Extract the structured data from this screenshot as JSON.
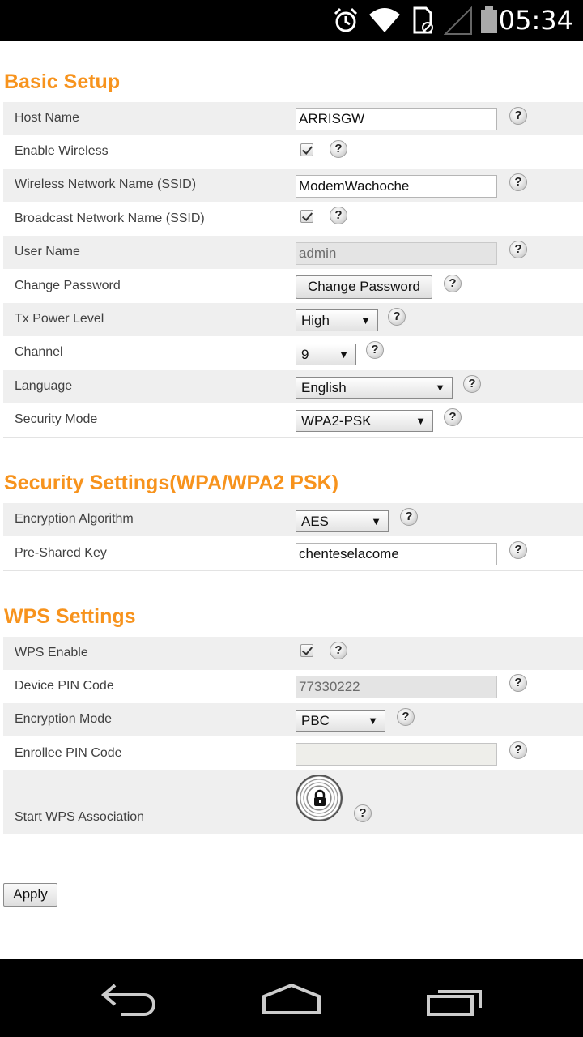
{
  "status_bar": {
    "time": "05:34",
    "icons": [
      "alarm-icon",
      "wifi-icon",
      "sim-icon",
      "signal-icon",
      "battery-icon"
    ]
  },
  "basic_setup": {
    "title": "Basic Setup",
    "host_name": {
      "label": "Host Name",
      "value": "ARRISGW"
    },
    "enable_wireless": {
      "label": "Enable Wireless",
      "checked": true
    },
    "ssid": {
      "label": "Wireless Network Name (SSID)",
      "value": "ModemWachoche"
    },
    "broadcast_ssid": {
      "label": "Broadcast Network Name (SSID)",
      "checked": true
    },
    "user_name": {
      "label": "User Name",
      "value": "admin"
    },
    "change_password": {
      "label": "Change Password",
      "button": "Change Password"
    },
    "tx_power": {
      "label": "Tx Power Level",
      "value": "High"
    },
    "channel": {
      "label": "Channel",
      "value": "9"
    },
    "language": {
      "label": "Language",
      "value": "English"
    },
    "security_mode": {
      "label": "Security Mode",
      "value": "WPA2-PSK"
    }
  },
  "security_settings": {
    "title": "Security Settings(WPA/WPA2 PSK)",
    "encryption_algorithm": {
      "label": "Encryption Algorithm",
      "value": "AES"
    },
    "pre_shared_key": {
      "label": "Pre-Shared Key",
      "value": "chenteselacome"
    }
  },
  "wps_settings": {
    "title": "WPS Settings",
    "wps_enable": {
      "label": "WPS Enable",
      "checked": true
    },
    "device_pin": {
      "label": "Device PIN Code",
      "value": "77330222"
    },
    "encryption_mode": {
      "label": "Encryption Mode",
      "value": "PBC"
    },
    "enrollee_pin": {
      "label": "Enrollee PIN Code",
      "value": ""
    },
    "start_wps": {
      "label": "Start WPS Association"
    }
  },
  "help_glyph": "?",
  "select_arrow": "▼",
  "apply_label": "Apply",
  "colors": {
    "accent": "#f7931d",
    "row_shade": "#efefef",
    "bar": "#000000"
  }
}
